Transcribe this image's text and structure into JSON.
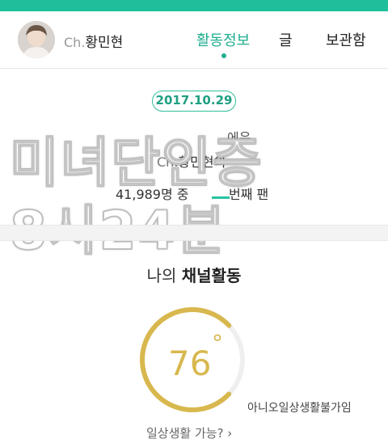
{
  "header": {
    "channel_prefix": "Ch.",
    "channel_name": "황민현",
    "tabs": [
      {
        "label": "활동정보",
        "active": true
      },
      {
        "label": "글",
        "active": false
      },
      {
        "label": "보관함",
        "active": false
      }
    ]
  },
  "profile": {
    "date": "2017.10.29",
    "suffix_text": "에은",
    "channel_prefix": "Ch.",
    "channel_name": "황민현의",
    "member_count": "41,989명 중",
    "ordinal_tail": "번째 팬"
  },
  "overlay": {
    "line1": "미녀단인증",
    "line2": "8시24분"
  },
  "activity": {
    "title_plain": "나의 ",
    "title_bold": "채널활동",
    "temperature": 76,
    "temperature_text": "76",
    "degree_symbol": "°",
    "label": "아니오일상생활불가임",
    "question": "일상생활 가능? ›"
  },
  "colors": {
    "accent": "#1fae8f",
    "top_bar": "#1fbf9b",
    "gauge": "#d8b84e",
    "gauge_track": "#efefef"
  },
  "icons": {
    "tab_indicator": "dot-icon",
    "chevron": "chevron-right-icon"
  }
}
